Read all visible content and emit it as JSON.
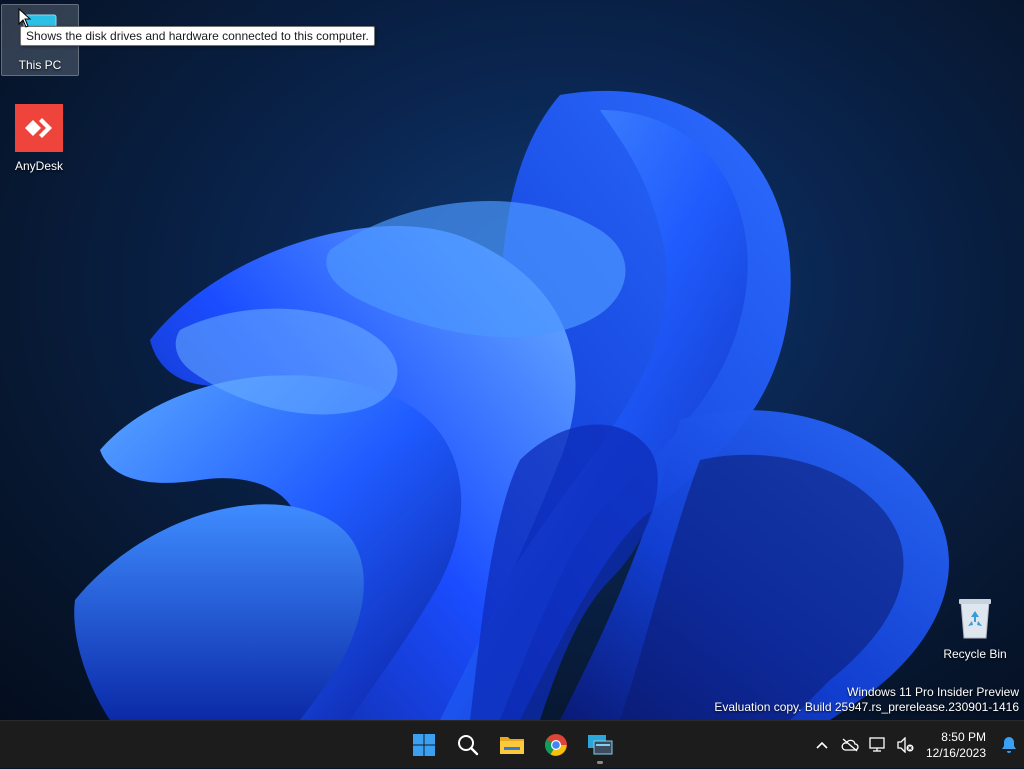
{
  "desktop": {
    "icons": [
      {
        "label": "This PC",
        "icon": "this-pc-icon"
      },
      {
        "label": "AnyDesk",
        "icon": "anydesk-icon"
      },
      {
        "label": "Recycle Bin",
        "icon": "recycle-bin-icon"
      }
    ],
    "tooltip": "Shows the disk drives and hardware connected to this computer.",
    "watermark": {
      "line1": "Windows 11 Pro Insider Preview",
      "line2": "Evaluation copy. Build 25947.rs_prerelease.230901-1416"
    }
  },
  "taskbar": {
    "apps": [
      {
        "name": "Start",
        "icon": "windows-start-icon"
      },
      {
        "name": "Search",
        "icon": "search-icon"
      },
      {
        "name": "File Explorer",
        "icon": "folder-icon"
      },
      {
        "name": "Google Chrome",
        "icon": "chrome-icon"
      },
      {
        "name": "Remote Desktop",
        "icon": "remote-desktop-icon",
        "running": true
      }
    ],
    "tray": {
      "time": "8:50 PM",
      "date": "12/16/2023"
    }
  },
  "colors": {
    "taskbar_bg": "#1c1c1c",
    "start_blue": "#3aa0f3",
    "anydesk_red": "#ef443b",
    "wallpaper_blue": "#1f5bff"
  }
}
